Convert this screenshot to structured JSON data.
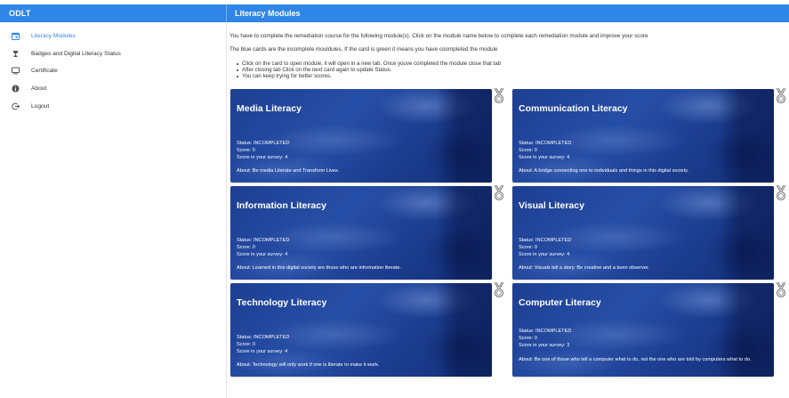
{
  "header": {
    "brand": "ODLT",
    "title": "Literacy Modules"
  },
  "sidebar": {
    "items": [
      {
        "label": "Literacy Modules",
        "icon": "calendar-icon",
        "active": true
      },
      {
        "label": "Badges and Digital Literacy Status",
        "icon": "trophy-icon",
        "active": false
      },
      {
        "label": "Certificate",
        "icon": "monitor-icon",
        "active": false
      },
      {
        "label": "About",
        "icon": "info-icon",
        "active": false
      },
      {
        "label": "Logout",
        "icon": "logout-icon",
        "active": false
      }
    ]
  },
  "main": {
    "intro1": "You have to complete the remediation course for the following module(s). Click on the module name below to complete each remediation module and improve your score",
    "intro2": "The blue cards are the incomplete mouldules. If the card is green it means you have coompleted the module",
    "bullets": [
      "Click on the card to open module, it will open in a new tab. Once youve completed the module close that tab",
      "After closing tab Click on the next card again to update Status.",
      "You can keep trying for better scores."
    ]
  },
  "modules": [
    {
      "title": "Media Literacy",
      "status": "Status: INCOMPLETED",
      "score": "Score: 0",
      "survey": "Score in your survey: 4",
      "about": "About: Be media Literate and Transform Lives."
    },
    {
      "title": "Communication Literacy",
      "status": "Status: INCOMPLETED",
      "score": "Score: 0",
      "survey": "Score in your survey: 4",
      "about": "About: A bridge connecting one to individuals and things in this digital society."
    },
    {
      "title": "Information Literacy",
      "status": "Status: INCOMPLETED",
      "score": "Score: 0",
      "survey": "Score in your survey: 4",
      "about": "About: Learned in this digital society are those who are information literate."
    },
    {
      "title": "Visual Literacy",
      "status": "Status: INCOMPLETED",
      "score": "Score: 0",
      "survey": "Score in your survey: 4",
      "about": "About: Visuals tell a story. Be creative and a keen observer."
    },
    {
      "title": "Technology Literacy",
      "status": "Status: INCOMPLETED",
      "score": "Score: 0",
      "survey": "Score in your survey: 4",
      "about": "About: Technology will only work if one is literate to make it work."
    },
    {
      "title": "Computer Literacy",
      "status": "Status: INCOMPLETED",
      "score": "Score: 0",
      "survey": "Score in your survey: 3",
      "about": "About: Be one of those who tell a computer what to do, not the one who are told by computers what to do."
    }
  ],
  "colors": {
    "accent": "#2f86e8",
    "card_incomplete": "#1d3f93",
    "medal": "#777777"
  }
}
